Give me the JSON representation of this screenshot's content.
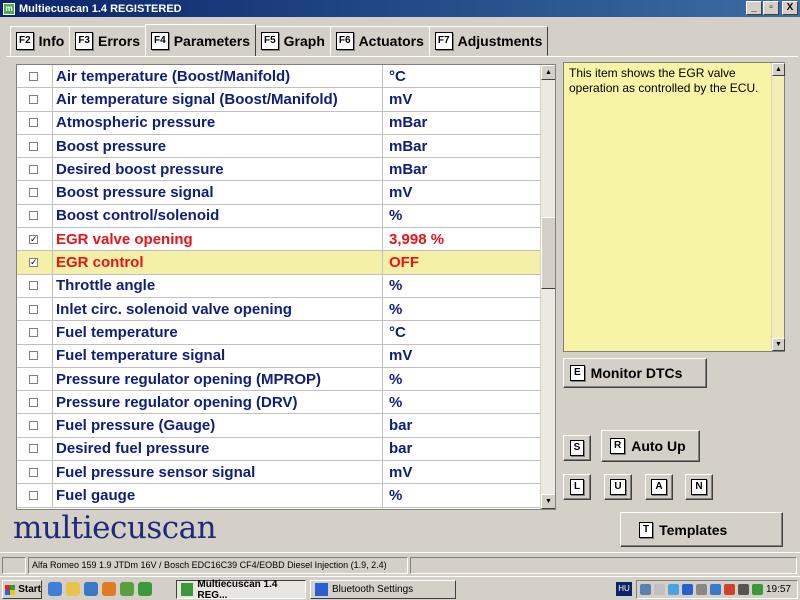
{
  "window": {
    "title": "Multiecuscan 1.4 REGISTERED",
    "buttons": {
      "minimize": "_",
      "restore": "▫",
      "close": "X"
    }
  },
  "tabs": [
    {
      "key": "F2",
      "label": "Info"
    },
    {
      "key": "F3",
      "label": "Errors"
    },
    {
      "key": "F4",
      "label": "Parameters",
      "active": true
    },
    {
      "key": "F5",
      "label": "Graph"
    },
    {
      "key": "F6",
      "label": "Actuators"
    },
    {
      "key": "F7",
      "label": "Adjustments"
    }
  ],
  "parameters": [
    {
      "checked": false,
      "name": "Air temperature (Boost/Manifold)",
      "value": "°C"
    },
    {
      "checked": false,
      "name": "Air temperature signal (Boost/Manifold)",
      "value": "mV"
    },
    {
      "checked": false,
      "name": "Atmospheric pressure",
      "value": "mBar"
    },
    {
      "checked": false,
      "name": "Boost pressure",
      "value": "mBar"
    },
    {
      "checked": false,
      "name": "Desired boost pressure",
      "value": "mBar"
    },
    {
      "checked": false,
      "name": "Boost pressure signal",
      "value": "mV"
    },
    {
      "checked": false,
      "name": "Boost control/solenoid",
      "value": "%"
    },
    {
      "checked": true,
      "name": "EGR valve opening",
      "value": "3,998 %",
      "style": "red"
    },
    {
      "checked": true,
      "name": "EGR control",
      "value": "OFF",
      "style": "red",
      "selected": true
    },
    {
      "checked": false,
      "name": "Throttle angle",
      "value": "%"
    },
    {
      "checked": false,
      "name": "Inlet circ. solenoid valve opening",
      "value": "%"
    },
    {
      "checked": false,
      "name": "Fuel temperature",
      "value": "°C"
    },
    {
      "checked": false,
      "name": "Fuel temperature signal",
      "value": "mV"
    },
    {
      "checked": false,
      "name": "Pressure regulator opening (MPROP)",
      "value": "%"
    },
    {
      "checked": false,
      "name": "Pressure regulator opening (DRV)",
      "value": "%"
    },
    {
      "checked": false,
      "name": "Fuel pressure (Gauge)",
      "value": "bar"
    },
    {
      "checked": false,
      "name": "Desired fuel pressure",
      "value": "bar"
    },
    {
      "checked": false,
      "name": "Fuel pressure sensor signal",
      "value": "mV"
    },
    {
      "checked": false,
      "name": "Fuel gauge",
      "value": "%"
    }
  ],
  "description": "This item shows the EGR valve operation as controlled by the ECU.",
  "buttons": {
    "monitor_dtcs": {
      "key": "E",
      "label": "Monitor DTCs"
    },
    "s": {
      "key": "S"
    },
    "auto_up": {
      "key": "R",
      "label": "Auto Up"
    },
    "l": {
      "key": "L"
    },
    "u": {
      "key": "U"
    },
    "a": {
      "key": "A"
    },
    "n": {
      "key": "N"
    },
    "templates": {
      "key": "T",
      "label": "Templates"
    }
  },
  "logo": "multiecuscan",
  "status": {
    "vehicle": "Alfa Romeo 159 1.9 JTDm 16V / Bosch EDC16C39 CF4/EOBD Diesel Injection (1.9, 2.4)"
  },
  "taskbar": {
    "start": "Start",
    "items": [
      {
        "label": "Multiecuscan 1.4 REG...",
        "active": true,
        "color": "#3a9a3a"
      },
      {
        "label": "Bluetooth Settings",
        "active": false,
        "color": "#2a5fd0"
      }
    ],
    "lang": "HU",
    "clock": "19:57"
  }
}
